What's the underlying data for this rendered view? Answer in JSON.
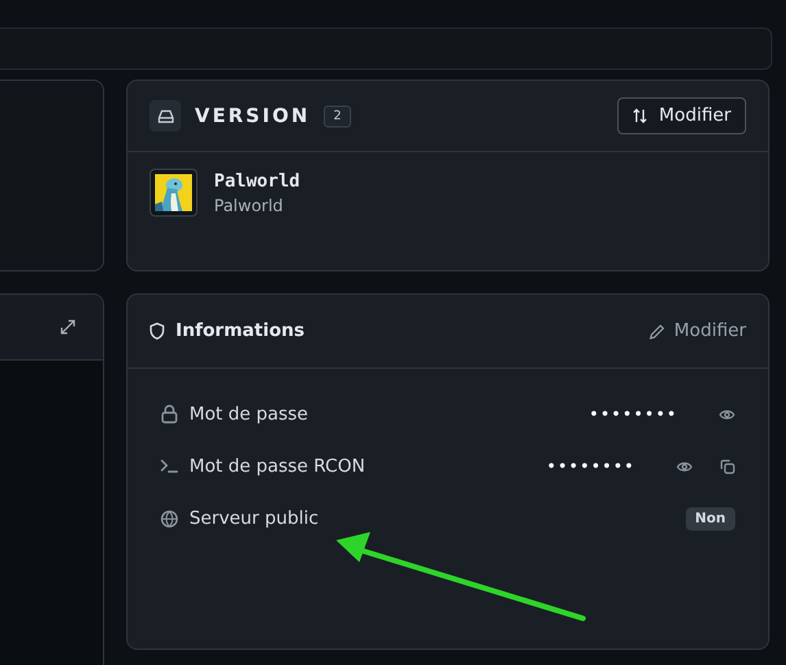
{
  "version": {
    "title": "VERSION",
    "count": "2",
    "button": "Modifier",
    "game": {
      "name": "Palworld",
      "subtitle": "Palworld",
      "kind": "picture"
    }
  },
  "informations": {
    "title": "Informations",
    "edit": "Modifier",
    "rows": [
      {
        "kind": "password",
        "label": "Mot de passe",
        "value": "••••••••"
      },
      {
        "kind": "rcon",
        "label": "Mot de passe RCON",
        "value": "••••••••"
      },
      {
        "kind": "public",
        "label": "Serveur public",
        "badge": "Non"
      }
    ]
  }
}
